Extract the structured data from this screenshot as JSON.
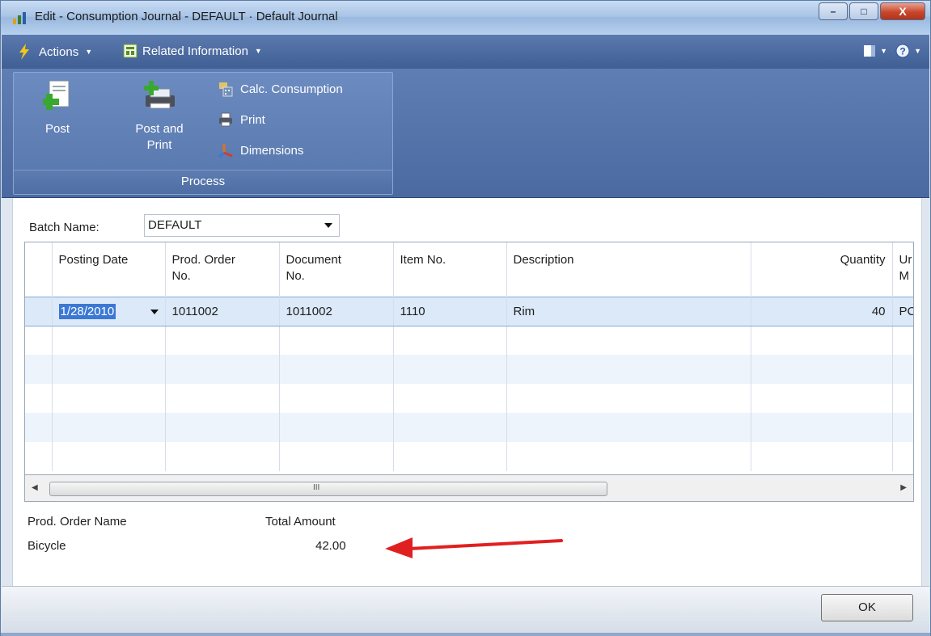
{
  "window": {
    "title": "Edit - Consumption Journal - DEFAULT · Default Journal",
    "controls": {
      "minimize": "–",
      "maximize": "□",
      "close": "X"
    }
  },
  "menubar": {
    "actions_label": "Actions",
    "related_label": "Related Information"
  },
  "ribbon": {
    "group_label": "Process",
    "post_label": "Post",
    "post_and_print_line1": "Post and",
    "post_and_print_line2": "Print",
    "calc_consumption_label": "Calc. Consumption",
    "print_label": "Print",
    "dimensions_label": "Dimensions"
  },
  "batch": {
    "label": "Batch Name:",
    "value": "DEFAULT"
  },
  "grid": {
    "columns": [
      {
        "line1": "Posting Date",
        "line2": ""
      },
      {
        "line1": "Prod. Order",
        "line2": "No."
      },
      {
        "line1": "Document",
        "line2": "No."
      },
      {
        "line1": "Item No.",
        "line2": ""
      },
      {
        "line1": "Description",
        "line2": ""
      },
      {
        "line1": "Quantity",
        "line2": ""
      },
      {
        "line1": "Ur",
        "line2": "M"
      }
    ],
    "rows": [
      {
        "posting_date": "1/28/2010",
        "prod_order_no": "1011002",
        "document_no": "1011002",
        "item_no": "1110",
        "description": "Rim",
        "quantity": "40",
        "unit": "PC"
      }
    ],
    "scroll_grip": "III"
  },
  "footer": {
    "prod_order_name_label": "Prod. Order Name",
    "prod_order_name_value": "Bicycle",
    "total_amount_label": "Total Amount",
    "total_amount_value": "42.00"
  },
  "buttons": {
    "ok_label": "OK"
  },
  "colors": {
    "annotation_arrow": "#e02020",
    "ribbon": "#4b6aa1",
    "selection": "#3b78d4"
  }
}
